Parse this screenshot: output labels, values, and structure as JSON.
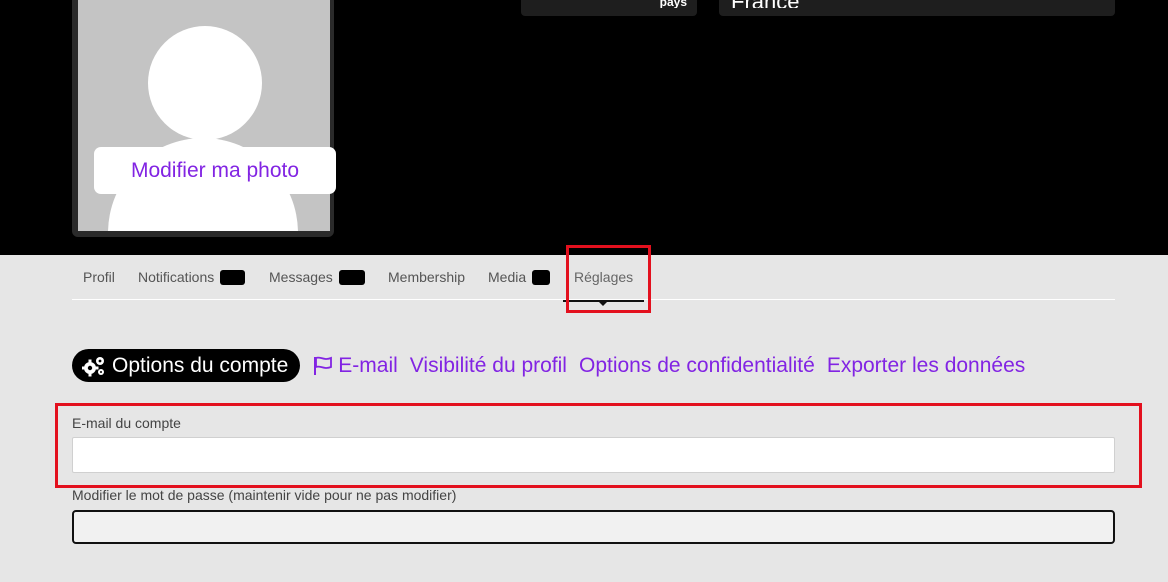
{
  "profile": {
    "photo_button_label": "Modifier ma photo",
    "meta_label": "pays",
    "meta_value": "France"
  },
  "tabs": [
    {
      "label": "Profil",
      "has_count": false
    },
    {
      "label": "Notifications",
      "has_count": true
    },
    {
      "label": "Messages",
      "has_count": true
    },
    {
      "label": "Membership",
      "has_count": false
    },
    {
      "label": "Media",
      "has_count": true
    },
    {
      "label": "Réglages",
      "has_count": false,
      "active": true
    }
  ],
  "subnav": {
    "active": "Options du compte",
    "links": [
      "E-mail",
      "Visibilité du profil",
      "Options de confidentialité",
      "Exporter les données"
    ]
  },
  "form": {
    "email_label": "E-mail du compte",
    "email_value": "",
    "password_label": "Modifier le mot de passe (maintenir vide pour ne pas modifier)",
    "password_value": ""
  },
  "colors": {
    "accent": "#8224e3",
    "highlight": "#e3101e",
    "hero_bg": "#000000",
    "page_bg": "#e6e6e6"
  }
}
